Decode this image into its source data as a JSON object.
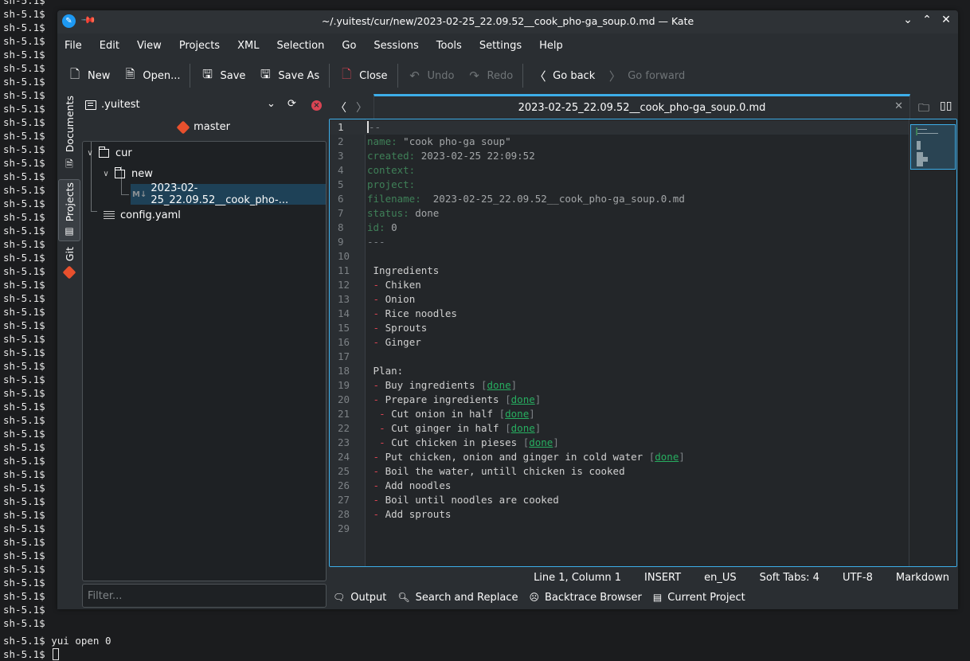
{
  "terminal": {
    "prompt": "sh-5.1$",
    "prompt_line_count": 47,
    "last_command": "yui open 0"
  },
  "window": {
    "title": "~/.yuitest/cur/new/2023-02-25_22.09.52__cook_pho-ga_soup.0.md — Kate",
    "controls": [
      "minimize",
      "maximize",
      "close"
    ]
  },
  "menubar": {
    "items": [
      "File",
      "Edit",
      "View",
      "Projects",
      "XML",
      "Selection",
      "Go",
      "Sessions",
      "Tools",
      "Settings",
      "Help"
    ]
  },
  "toolbar": {
    "new": "New",
    "open": "Open...",
    "save": "Save",
    "save_as": "Save As",
    "close": "Close",
    "undo": "Undo",
    "redo": "Redo",
    "go_back": "Go back",
    "go_forward": "Go forward"
  },
  "side_tabs": {
    "documents": "Documents",
    "projects": "Projects",
    "git": "Git"
  },
  "project_panel": {
    "project_name": ".yuitest",
    "branch": "master",
    "tree": [
      {
        "label": "cur",
        "type": "folder",
        "expanded": true,
        "depth": 0
      },
      {
        "label": "new",
        "type": "folder",
        "expanded": true,
        "depth": 1
      },
      {
        "label": "2023-02-25_22.09.52__cook_pho-...",
        "type": "markdown",
        "selected": true,
        "depth": 2
      },
      {
        "label": "config.yaml",
        "type": "text",
        "depth": 0
      }
    ],
    "filter_placeholder": "Filter..."
  },
  "tabs": {
    "active": "2023-02-25_22.09.52__cook_pho-ga_soup.0.md"
  },
  "editor": {
    "lines": [
      {
        "n": "1",
        "parts": [
          [
            "fm",
            "---"
          ]
        ]
      },
      {
        "n": "2",
        "parts": [
          [
            "key",
            "name:"
          ],
          [
            "val",
            " \"cook pho-ga soup\""
          ]
        ]
      },
      {
        "n": "3",
        "parts": [
          [
            "key",
            "created:"
          ],
          [
            "val",
            " 2023-02-25 22:09:52"
          ]
        ]
      },
      {
        "n": "4",
        "parts": [
          [
            "key",
            "context:"
          ]
        ]
      },
      {
        "n": "5",
        "parts": [
          [
            "key",
            "project:"
          ]
        ]
      },
      {
        "n": "6",
        "parts": [
          [
            "key",
            "filename:"
          ],
          [
            "val",
            "  2023-02-25_22.09.52__cook_pho-ga_soup.0.md"
          ]
        ]
      },
      {
        "n": "7",
        "parts": [
          [
            "key",
            "status:"
          ],
          [
            "val",
            " done"
          ]
        ]
      },
      {
        "n": "8",
        "parts": [
          [
            "key",
            "id:"
          ],
          [
            "val",
            " 0"
          ]
        ]
      },
      {
        "n": "9",
        "parts": [
          [
            "fm",
            "---"
          ]
        ]
      },
      {
        "n": "10",
        "parts": []
      },
      {
        "n": "11",
        "parts": [
          [
            "txt",
            " Ingredients"
          ]
        ]
      },
      {
        "n": "12",
        "parts": [
          [
            "txt",
            " "
          ],
          [
            "dash",
            "-"
          ],
          [
            "txt",
            " Chiken"
          ]
        ]
      },
      {
        "n": "13",
        "parts": [
          [
            "txt",
            " "
          ],
          [
            "dash",
            "-"
          ],
          [
            "txt",
            " Onion"
          ]
        ]
      },
      {
        "n": "14",
        "parts": [
          [
            "txt",
            " "
          ],
          [
            "dash",
            "-"
          ],
          [
            "txt",
            " Rice noodles"
          ]
        ]
      },
      {
        "n": "15",
        "parts": [
          [
            "txt",
            " "
          ],
          [
            "dash",
            "-"
          ],
          [
            "txt",
            " Sprouts"
          ]
        ]
      },
      {
        "n": "16",
        "parts": [
          [
            "txt",
            " "
          ],
          [
            "dash",
            "-"
          ],
          [
            "txt",
            " Ginger"
          ]
        ]
      },
      {
        "n": "17",
        "parts": []
      },
      {
        "n": "18",
        "parts": [
          [
            "txt",
            " Plan:"
          ]
        ]
      },
      {
        "n": "19",
        "parts": [
          [
            "txt",
            " "
          ],
          [
            "dash",
            "-"
          ],
          [
            "txt",
            " Buy ingredients "
          ],
          [
            "br",
            "["
          ],
          [
            "done",
            "done"
          ],
          [
            "br",
            "]"
          ]
        ]
      },
      {
        "n": "20",
        "parts": [
          [
            "txt",
            " "
          ],
          [
            "dash",
            "-"
          ],
          [
            "txt",
            " Prepare ingredients "
          ],
          [
            "br",
            "["
          ],
          [
            "done",
            "done"
          ],
          [
            "br",
            "]"
          ]
        ]
      },
      {
        "n": "21",
        "parts": [
          [
            "txt",
            "  "
          ],
          [
            "dash",
            "-"
          ],
          [
            "txt",
            " Cut onion in half "
          ],
          [
            "br",
            "["
          ],
          [
            "done",
            "done"
          ],
          [
            "br",
            "]"
          ]
        ]
      },
      {
        "n": "22",
        "parts": [
          [
            "txt",
            "  "
          ],
          [
            "dash",
            "-"
          ],
          [
            "txt",
            " Cut ginger in half "
          ],
          [
            "br",
            "["
          ],
          [
            "done",
            "done"
          ],
          [
            "br",
            "]"
          ]
        ]
      },
      {
        "n": "23",
        "parts": [
          [
            "txt",
            "  "
          ],
          [
            "dash",
            "-"
          ],
          [
            "txt",
            " Cut chicken in pieses "
          ],
          [
            "br",
            "["
          ],
          [
            "done",
            "done"
          ],
          [
            "br",
            "]"
          ]
        ]
      },
      {
        "n": "24",
        "parts": [
          [
            "txt",
            " "
          ],
          [
            "dash",
            "-"
          ],
          [
            "txt",
            " Put chicken, onion and ginger in cold water "
          ],
          [
            "br",
            "["
          ],
          [
            "done",
            "done"
          ],
          [
            "br",
            "]"
          ]
        ]
      },
      {
        "n": "25",
        "parts": [
          [
            "txt",
            " "
          ],
          [
            "dash",
            "-"
          ],
          [
            "txt",
            " Boil the water, untill chicken is cooked"
          ]
        ]
      },
      {
        "n": "26",
        "parts": [
          [
            "txt",
            " "
          ],
          [
            "dash",
            "-"
          ],
          [
            "txt",
            " Add noodles"
          ]
        ]
      },
      {
        "n": "27",
        "parts": [
          [
            "txt",
            " "
          ],
          [
            "dash",
            "-"
          ],
          [
            "txt",
            " Boil until noodles are cooked"
          ]
        ]
      },
      {
        "n": "28",
        "parts": [
          [
            "txt",
            " "
          ],
          [
            "dash",
            "-"
          ],
          [
            "txt",
            " Add sprouts"
          ]
        ]
      },
      {
        "n": "29",
        "parts": []
      }
    ]
  },
  "statusbar": {
    "position": "Line 1, Column 1",
    "mode": "INSERT",
    "dictionary": "en_US",
    "indent": "Soft Tabs: 4",
    "encoding": "UTF-8",
    "syntax": "Markdown"
  },
  "bottom_panel": {
    "output": "Output",
    "search": "Search and Replace",
    "backtrace": "Backtrace Browser",
    "current_project": "Current Project"
  },
  "colors": {
    "accent": "#3daee9",
    "yaml_key": "#3f8058",
    "list_dash": "#da4453",
    "done_link": "#27ae60",
    "git": "#e8502d",
    "selection": "#1e4157"
  }
}
